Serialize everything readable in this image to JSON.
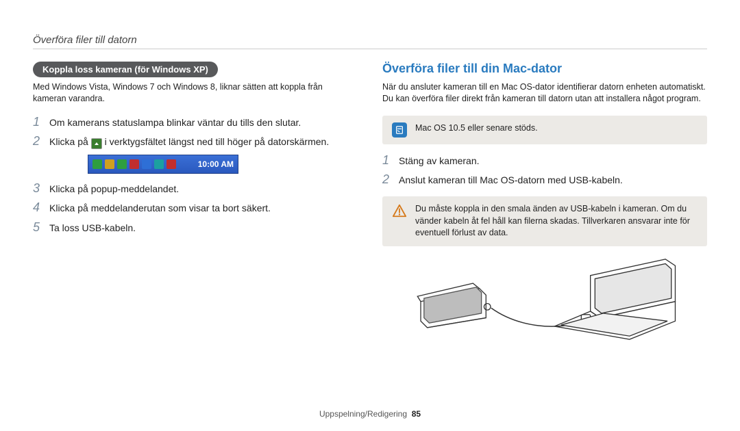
{
  "header": {
    "title": "Överföra filer till datorn"
  },
  "left": {
    "pill": "Koppla loss kameran (för Windows XP)",
    "intro": "Med Windows Vista, Windows 7 och Windows 8, liknar sätten att koppla från kameran varandra.",
    "steps": {
      "s1": "Om kamerans statuslampa blinkar väntar du tills den slutar.",
      "s2a": "Klicka på ",
      "s2b": " i verktygsfältet längst ned till höger på datorskärmen.",
      "s3": "Klicka på popup-meddelandet.",
      "s4": "Klicka på meddelanderutan som visar ta bort säkert.",
      "s5": "Ta loss USB-kabeln."
    },
    "taskbar_clock": "10:00 AM"
  },
  "right": {
    "heading": "Överföra filer till din Mac-dator",
    "intro": "När du ansluter kameran till en Mac OS-dator identifierar datorn enheten automatiskt. Du kan överföra filer direkt från kameran till datorn utan att installera något program.",
    "note": "Mac OS 10.5 eller senare stöds.",
    "steps": {
      "s1": "Stäng av kameran.",
      "s2": "Anslut kameran till Mac OS-datorn med USB-kabeln."
    },
    "warning": "Du måste koppla in den smala änden av USB-kabeln i kameran. Om du vänder kabeln åt fel håll kan filerna skadas. Tillverkaren ansvarar inte för eventuell förlust av data."
  },
  "footer": {
    "section": "Uppspelning/Redigering",
    "page": "85"
  },
  "nums": {
    "1": "1",
    "2": "2",
    "3": "3",
    "4": "4",
    "5": "5"
  }
}
